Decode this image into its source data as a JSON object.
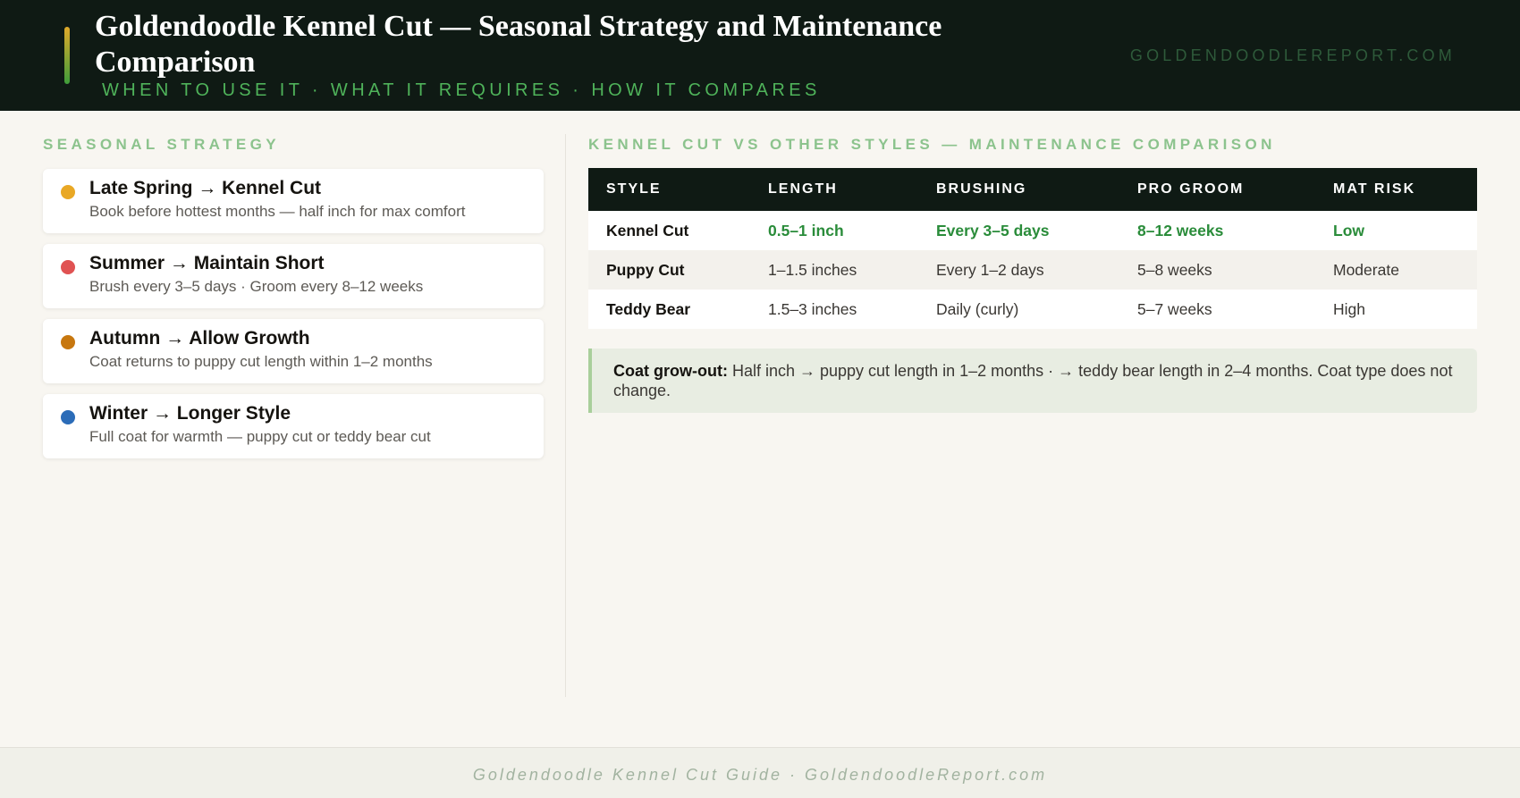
{
  "header": {
    "title": "Goldendoodle Kennel Cut — Seasonal Strategy and Maintenance Comparison",
    "subtitle": "WHEN TO USE IT · WHAT IT REQUIRES · HOW IT COMPARES",
    "site": "GOLDENDOODLEREPORT.COM"
  },
  "seasonal": {
    "heading": "SEASONAL STRATEGY",
    "items": [
      {
        "title": "Late Spring → Kennel Cut",
        "desc": "Book before hottest months — half inch for max comfort",
        "color": "#e9a825"
      },
      {
        "title": "Summer → Maintain Short",
        "desc": "Brush every 3–5 days · Groom every 8–12 weeks",
        "color": "#e05252"
      },
      {
        "title": "Autumn → Allow Growth",
        "desc": "Coat returns to puppy cut length within 1–2 months",
        "color": "#c7770f"
      },
      {
        "title": "Winter → Longer Style",
        "desc": "Full coat for warmth — puppy cut or teddy bear cut",
        "color": "#2b6cb8"
      }
    ]
  },
  "comparison": {
    "heading": "KENNEL CUT VS OTHER STYLES — MAINTENANCE COMPARISON",
    "columns": [
      "STYLE",
      "LENGTH",
      "BRUSHING",
      "PRO GROOM",
      "MAT RISK"
    ],
    "rows": [
      [
        "Kennel Cut",
        "0.5–1 inch",
        "Every 3–5 days",
        "8–12 weeks",
        "Low"
      ],
      [
        "Puppy Cut",
        "1–1.5 inches",
        "Every 1–2 days",
        "5–8 weeks",
        "Moderate"
      ],
      [
        "Teddy Bear",
        "1.5–3 inches",
        "Daily (curly)",
        "5–7 weeks",
        "High"
      ]
    ],
    "highlight_color": "#2a8c3a"
  },
  "note": {
    "label": "Coat grow-out:",
    "text": " Half inch → puppy cut length in 1–2 months · → teddy bear length in 2–4 months. Coat type does not change."
  },
  "footer": {
    "text": "Goldendoodle Kennel Cut Guide · GoldendoodleReport.com"
  }
}
